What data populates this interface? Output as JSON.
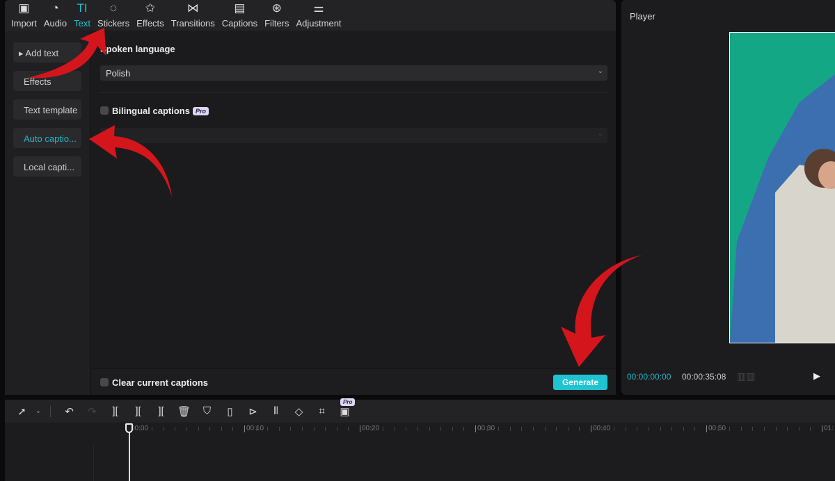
{
  "toolbar": {
    "tabs": [
      {
        "label": "Import",
        "icon": "import-icon",
        "glyph": "▣"
      },
      {
        "label": "Audio",
        "icon": "audio-icon",
        "glyph": "◔"
      },
      {
        "label": "Text",
        "icon": "text-icon",
        "glyph": "TI"
      },
      {
        "label": "Stickers",
        "icon": "stickers-icon",
        "glyph": "◌"
      },
      {
        "label": "Effects",
        "icon": "effects-icon",
        "glyph": "✩"
      },
      {
        "label": "Transitions",
        "icon": "transitions-icon",
        "glyph": "⋈"
      },
      {
        "label": "Captions",
        "icon": "captions-icon",
        "glyph": "▤"
      },
      {
        "label": "Filters",
        "icon": "filters-icon",
        "glyph": "⊛"
      },
      {
        "label": "Adjustment",
        "icon": "adjustment-icon",
        "glyph": "⚌"
      }
    ],
    "active": "Text"
  },
  "sidebar": {
    "items": [
      {
        "label": "▸ Add text"
      },
      {
        "label": "Effects"
      },
      {
        "label": "Text template"
      },
      {
        "label": "Auto captio..."
      },
      {
        "label": "Local capti..."
      }
    ],
    "active": "Auto captio..."
  },
  "main": {
    "spoken_language_label": "Spoken language",
    "spoken_language_value": "Polish",
    "bilingual_label": "Bilingual captions",
    "pro_badge": "Pro",
    "clear_label": "Clear current captions",
    "generate_label": "Generate"
  },
  "player": {
    "title": "Player",
    "current_time": "00:00:00:00",
    "duration": "00:00:35:08"
  },
  "timeline": {
    "pro_badge": "Pro",
    "ruler_labels": [
      "00:00",
      "00:10",
      "00:20",
      "00:30",
      "00:40",
      "00:50",
      "01:"
    ]
  },
  "colors": {
    "accent": "#1fc4d2",
    "arrow": "#d4161c",
    "green_screen": "#14a786"
  }
}
